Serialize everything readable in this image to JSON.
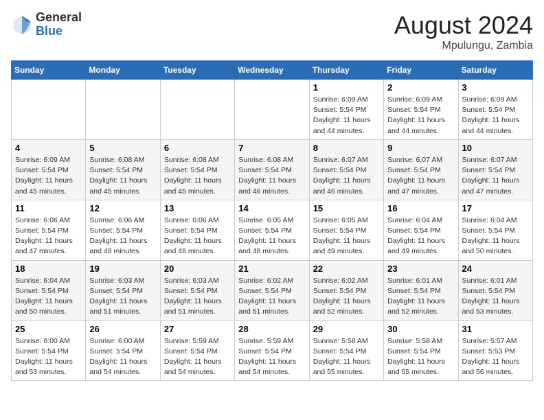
{
  "header": {
    "logo_general": "General",
    "logo_blue": "Blue",
    "month_year": "August 2024",
    "location": "Mpulungu, Zambia"
  },
  "weekdays": [
    "Sunday",
    "Monday",
    "Tuesday",
    "Wednesday",
    "Thursday",
    "Friday",
    "Saturday"
  ],
  "weeks": [
    [
      {
        "day": "",
        "info": ""
      },
      {
        "day": "",
        "info": ""
      },
      {
        "day": "",
        "info": ""
      },
      {
        "day": "",
        "info": ""
      },
      {
        "day": "1",
        "info": "Sunrise: 6:09 AM\nSunset: 5:54 PM\nDaylight: 11 hours\nand 44 minutes."
      },
      {
        "day": "2",
        "info": "Sunrise: 6:09 AM\nSunset: 5:54 PM\nDaylight: 11 hours\nand 44 minutes."
      },
      {
        "day": "3",
        "info": "Sunrise: 6:09 AM\nSunset: 5:54 PM\nDaylight: 11 hours\nand 44 minutes."
      }
    ],
    [
      {
        "day": "4",
        "info": "Sunrise: 6:09 AM\nSunset: 5:54 PM\nDaylight: 11 hours\nand 45 minutes."
      },
      {
        "day": "5",
        "info": "Sunrise: 6:08 AM\nSunset: 5:54 PM\nDaylight: 11 hours\nand 45 minutes."
      },
      {
        "day": "6",
        "info": "Sunrise: 6:08 AM\nSunset: 5:54 PM\nDaylight: 11 hours\nand 45 minutes."
      },
      {
        "day": "7",
        "info": "Sunrise: 6:08 AM\nSunset: 5:54 PM\nDaylight: 11 hours\nand 46 minutes."
      },
      {
        "day": "8",
        "info": "Sunrise: 6:07 AM\nSunset: 5:54 PM\nDaylight: 11 hours\nand 46 minutes."
      },
      {
        "day": "9",
        "info": "Sunrise: 6:07 AM\nSunset: 5:54 PM\nDaylight: 11 hours\nand 47 minutes."
      },
      {
        "day": "10",
        "info": "Sunrise: 6:07 AM\nSunset: 5:54 PM\nDaylight: 11 hours\nand 47 minutes."
      }
    ],
    [
      {
        "day": "11",
        "info": "Sunrise: 6:06 AM\nSunset: 5:54 PM\nDaylight: 11 hours\nand 47 minutes."
      },
      {
        "day": "12",
        "info": "Sunrise: 6:06 AM\nSunset: 5:54 PM\nDaylight: 11 hours\nand 48 minutes."
      },
      {
        "day": "13",
        "info": "Sunrise: 6:06 AM\nSunset: 5:54 PM\nDaylight: 11 hours\nand 48 minutes."
      },
      {
        "day": "14",
        "info": "Sunrise: 6:05 AM\nSunset: 5:54 PM\nDaylight: 11 hours\nand 48 minutes."
      },
      {
        "day": "15",
        "info": "Sunrise: 6:05 AM\nSunset: 5:54 PM\nDaylight: 11 hours\nand 49 minutes."
      },
      {
        "day": "16",
        "info": "Sunrise: 6:04 AM\nSunset: 5:54 PM\nDaylight: 11 hours\nand 49 minutes."
      },
      {
        "day": "17",
        "info": "Sunrise: 6:04 AM\nSunset: 5:54 PM\nDaylight: 11 hours\nand 50 minutes."
      }
    ],
    [
      {
        "day": "18",
        "info": "Sunrise: 6:04 AM\nSunset: 5:54 PM\nDaylight: 11 hours\nand 50 minutes."
      },
      {
        "day": "19",
        "info": "Sunrise: 6:03 AM\nSunset: 5:54 PM\nDaylight: 11 hours\nand 51 minutes."
      },
      {
        "day": "20",
        "info": "Sunrise: 6:03 AM\nSunset: 5:54 PM\nDaylight: 11 hours\nand 51 minutes."
      },
      {
        "day": "21",
        "info": "Sunrise: 6:02 AM\nSunset: 5:54 PM\nDaylight: 11 hours\nand 51 minutes."
      },
      {
        "day": "22",
        "info": "Sunrise: 6:02 AM\nSunset: 5:54 PM\nDaylight: 11 hours\nand 52 minutes."
      },
      {
        "day": "23",
        "info": "Sunrise: 6:01 AM\nSunset: 5:54 PM\nDaylight: 11 hours\nand 52 minutes."
      },
      {
        "day": "24",
        "info": "Sunrise: 6:01 AM\nSunset: 5:54 PM\nDaylight: 11 hours\nand 53 minutes."
      }
    ],
    [
      {
        "day": "25",
        "info": "Sunrise: 6:00 AM\nSunset: 5:54 PM\nDaylight: 11 hours\nand 53 minutes."
      },
      {
        "day": "26",
        "info": "Sunrise: 6:00 AM\nSunset: 5:54 PM\nDaylight: 11 hours\nand 54 minutes."
      },
      {
        "day": "27",
        "info": "Sunrise: 5:59 AM\nSunset: 5:54 PM\nDaylight: 11 hours\nand 54 minutes."
      },
      {
        "day": "28",
        "info": "Sunrise: 5:59 AM\nSunset: 5:54 PM\nDaylight: 11 hours\nand 54 minutes."
      },
      {
        "day": "29",
        "info": "Sunrise: 5:58 AM\nSunset: 5:54 PM\nDaylight: 11 hours\nand 55 minutes."
      },
      {
        "day": "30",
        "info": "Sunrise: 5:58 AM\nSunset: 5:54 PM\nDaylight: 11 hours\nand 55 minutes."
      },
      {
        "day": "31",
        "info": "Sunrise: 5:57 AM\nSunset: 5:53 PM\nDaylight: 11 hours\nand 56 minutes."
      }
    ]
  ]
}
